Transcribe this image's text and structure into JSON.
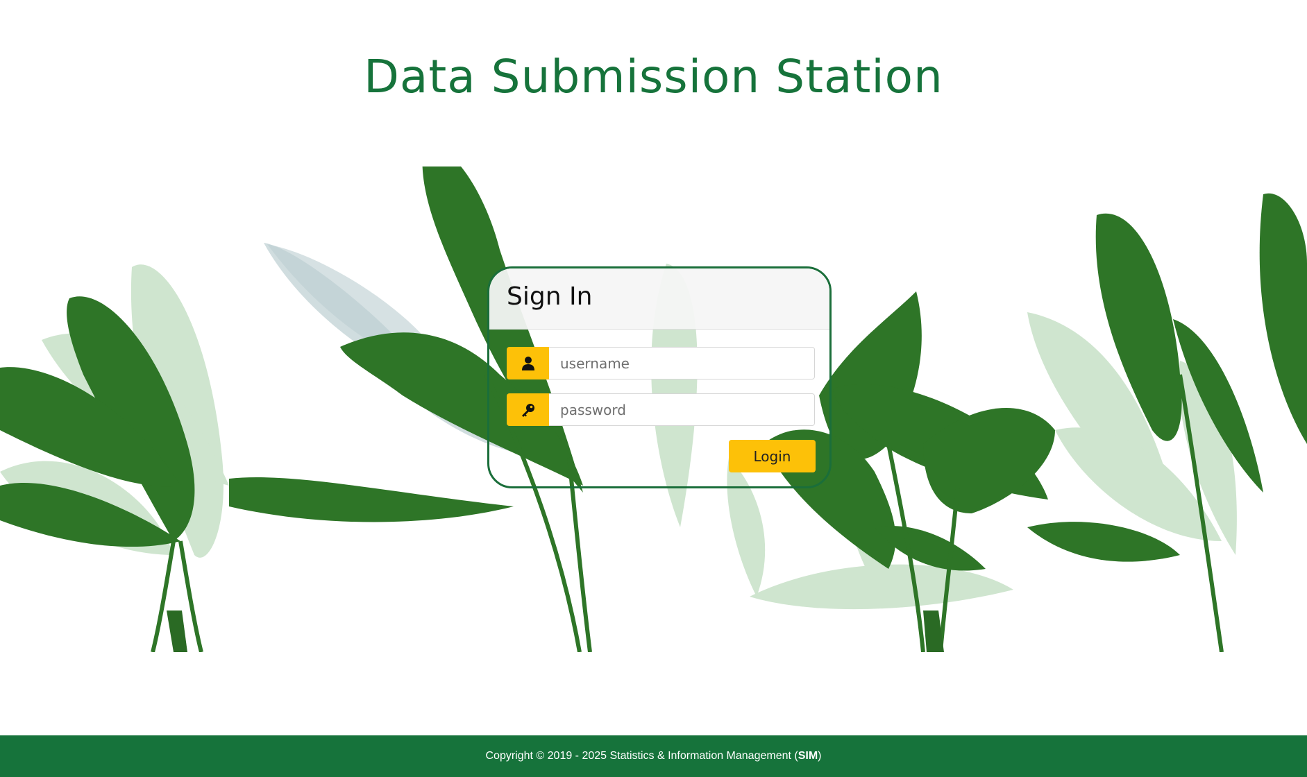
{
  "page": {
    "title": "Data Submission Station"
  },
  "login_card": {
    "title": "Sign In",
    "username_placeholder": "username",
    "password_placeholder": "password",
    "login_label": "Login"
  },
  "footer": {
    "prefix": "Copyright © 2019 - 2025 Statistics & Information Management (",
    "acronym": "SIM",
    "suffix": ")"
  },
  "icons": {
    "username": "user-icon",
    "password": "key-icon"
  },
  "colors": {
    "brand_green": "#16733b",
    "accent_yellow": "#fdc108",
    "leaf_dark": "#2e7527",
    "leaf_light": "#9ccc9c"
  }
}
